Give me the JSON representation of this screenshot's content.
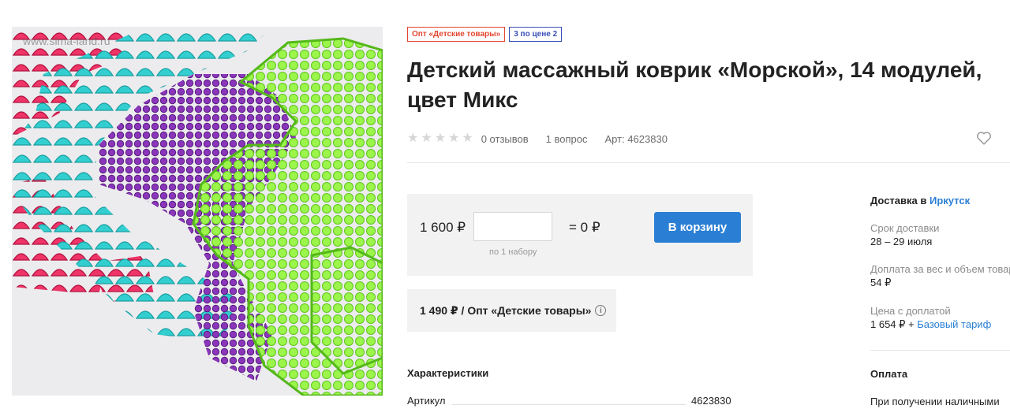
{
  "image": {
    "watermark": "www.sima-land.ru",
    "colors": {
      "pink": "#e8245d",
      "teal": "#28c0c2",
      "purple": "#7a2aa8",
      "green": "#8ef03a"
    }
  },
  "badges": [
    {
      "label": "Опт «Детские товары»",
      "color": "#e3452f"
    },
    {
      "label": "3 по цене 2",
      "color": "#3a4fb6"
    }
  ],
  "title": "Детский массажный коврик «Морской», 14 модулей, цвет Микс",
  "rating": {
    "stars": 5,
    "filled": 0,
    "reviews_label": "0 отзывов"
  },
  "questions_label": "1 вопрос",
  "article_label": "Арт: 4623830",
  "buy": {
    "price": "1 600 ₽",
    "qty_value": "",
    "qty_note": "по 1 набору",
    "total": "= 0 ₽",
    "cart_button": "В корзину",
    "accent_color": "#2a7fd4"
  },
  "wholesale": {
    "text": "1 490 ₽ / Опт «Детские товары»"
  },
  "characteristics": {
    "heading": "Характеристики",
    "rows": [
      {
        "label": "Артикул",
        "value": "4623830"
      }
    ]
  },
  "delivery": {
    "heading_prefix": "Доставка в",
    "city": "Иркутск",
    "items": [
      {
        "label": "Срок доставки",
        "value": "28 – 29 июля"
      },
      {
        "label": "Доплата за вес и объем товара",
        "value": "54 ₽"
      },
      {
        "label": "Цена с доплатой",
        "value": "1 654 ₽ +",
        "link": "Базовый тариф"
      }
    ]
  },
  "payment": {
    "heading": "Оплата",
    "items": [
      "При получении наличными"
    ]
  }
}
